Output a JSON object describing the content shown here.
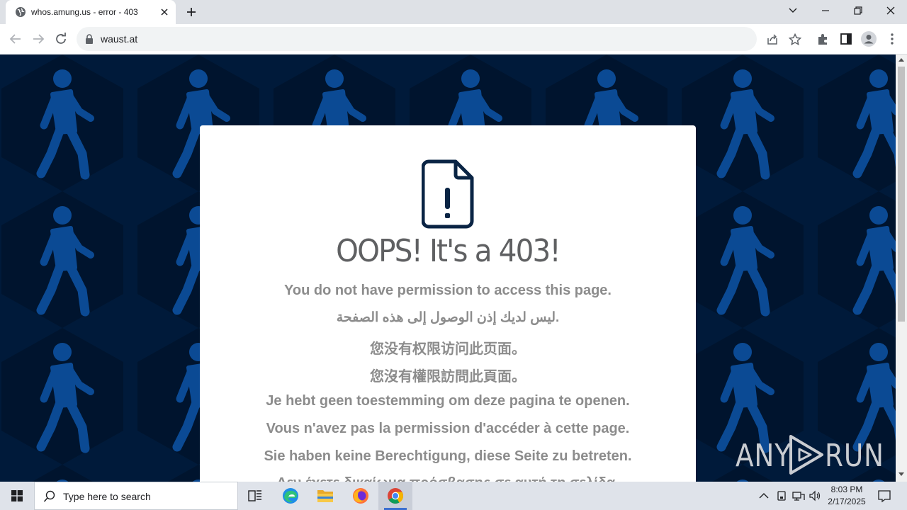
{
  "browser": {
    "tab_title": "whos.amung.us - error - 403",
    "url": "waust.at"
  },
  "page": {
    "heading": "OOPS! It's a 403!",
    "messages": [
      "You do not have permission to access this page.",
      "ليس لديك إذن الوصول إلى هذه الصفحة.",
      "您没有权限访问此页面。",
      "您沒有權限訪問此頁面。",
      "Je hebt geen toestemming om deze pagina te openen.",
      "Vous n'avez pas la permission d'accéder à cette page.",
      "Sie haben keine Berechtigung, diese Seite zu betreten.",
      "Δεν έχετε δικαίωμα πρόσβασης σε αυτή τη σελίδα."
    ]
  },
  "watermark": {
    "left": "ANY",
    "right": "RUN"
  },
  "taskbar": {
    "search_placeholder": "Type here to search",
    "time": "8:03 PM",
    "date": "2/17/2025"
  },
  "colors": {
    "page_bg": "#001a3a",
    "hexagon": "#00142e",
    "walker": "#0b4a94",
    "heading": "#5f6062",
    "message": "#8c8c8c"
  },
  "icons": [
    "globe-icon",
    "close-icon",
    "plus-icon",
    "back-icon",
    "forward-icon",
    "reload-icon",
    "lock-icon",
    "share-icon",
    "star-icon",
    "extensions-icon",
    "sidepanel-icon",
    "profile-icon",
    "menu-icon",
    "document-alert-icon",
    "windows-icon",
    "search-icon",
    "task-view-icon",
    "edge-icon",
    "file-explorer-icon",
    "firefox-icon",
    "chrome-icon"
  ]
}
